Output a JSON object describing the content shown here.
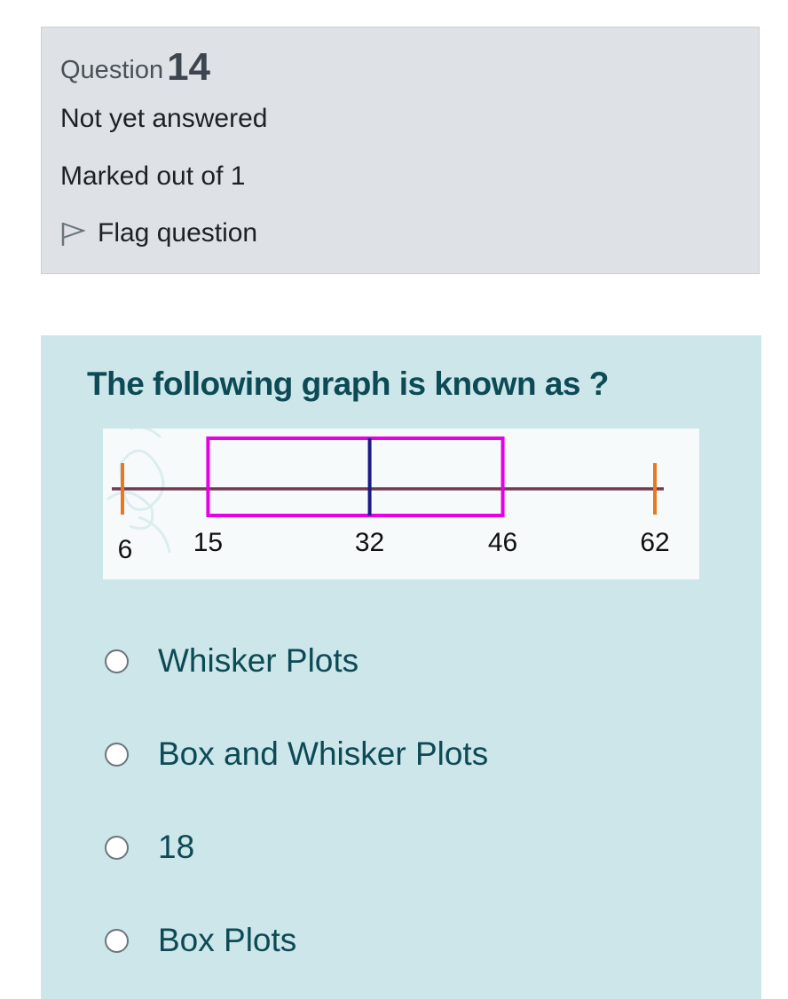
{
  "question": {
    "label": "Question",
    "number": "14",
    "state": "Not yet answered",
    "grade": "Marked out of 1",
    "flag_label": "Flag question",
    "text": "The following graph is known as ?"
  },
  "chart_data": {
    "type": "box",
    "min": 6,
    "q1": 15,
    "median": 32,
    "q3": 46,
    "max": 62,
    "tick_labels": [
      "6",
      "15",
      "32",
      "46",
      "62"
    ],
    "colors": {
      "axis_line": "#6e3b52",
      "whisker_caps": "#e87722",
      "box": "#e600e6",
      "median": "#1a1a8a"
    }
  },
  "answers": [
    {
      "label": "Whisker Plots"
    },
    {
      "label": "Box and Whisker Plots"
    },
    {
      "label": "18"
    },
    {
      "label": "Box Plots"
    }
  ],
  "colors": {
    "info_background": "#dee2e6",
    "content_background": "#cce6ea",
    "question_text": "#0c4a55"
  },
  "icons": {
    "flag": "flag-outline-icon",
    "radio": "radio-unchecked-icon"
  }
}
